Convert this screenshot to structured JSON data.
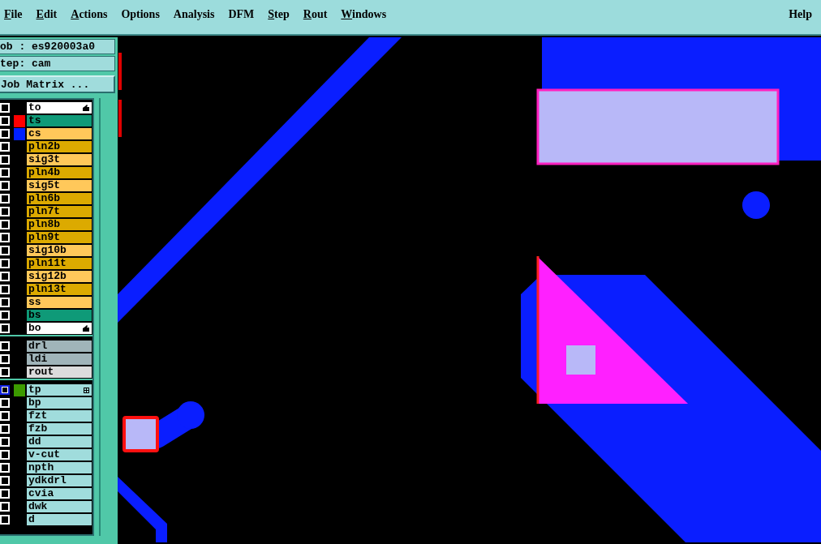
{
  "menu_bar": {
    "items": [
      {
        "label": "File",
        "underline_first": true
      },
      {
        "label": "Edit",
        "underline_first": true
      },
      {
        "label": "Actions",
        "underline_first": true
      },
      {
        "label": "Options",
        "underline_first": false
      },
      {
        "label": "Analysis",
        "underline_first": false
      },
      {
        "label": "DFM",
        "underline_first": false
      },
      {
        "label": "Step",
        "underline_first": true
      },
      {
        "label": "Rout",
        "underline_first": true
      },
      {
        "label": "Windows",
        "underline_first": true
      }
    ],
    "help": "Help"
  },
  "job_label": "ob : es920003a0",
  "step_label": "tep: cam",
  "job_matrix_button": "Job Matrix ...",
  "layer_groups": [
    {
      "layers": [
        {
          "name": "to",
          "color": "#ffffff",
          "kind": "hand",
          "selected": false
        },
        {
          "name": "ts",
          "color": "#0f9a78",
          "swatch": {
            "color": "#ff0000"
          },
          "kind": "plain",
          "selected": false
        },
        {
          "name": "cs",
          "color": "#ffc85a",
          "swatch": {
            "color": "#0020ff"
          },
          "kind": "plain",
          "selected": false
        },
        {
          "name": "pln2b",
          "color": "#dcaa00",
          "kind": "plain",
          "selected": false
        },
        {
          "name": "sig3t",
          "color": "#ffc85a",
          "kind": "plain",
          "selected": false
        },
        {
          "name": "pln4b",
          "color": "#dcaa00",
          "kind": "plain",
          "selected": false
        },
        {
          "name": "sig5t",
          "color": "#ffc85a",
          "kind": "plain",
          "selected": false
        },
        {
          "name": "pln6b",
          "color": "#dcaa00",
          "kind": "plain",
          "selected": false
        },
        {
          "name": "pln7t",
          "color": "#dcaa00",
          "kind": "plain",
          "selected": false
        },
        {
          "name": "pln8b",
          "color": "#dcaa00",
          "kind": "plain",
          "selected": false
        },
        {
          "name": "pln9t",
          "color": "#dcaa00",
          "kind": "plain",
          "selected": false
        },
        {
          "name": "sig10b",
          "color": "#ffc85a",
          "kind": "plain",
          "selected": false
        },
        {
          "name": "pln11t",
          "color": "#dcaa00",
          "kind": "plain",
          "selected": false
        },
        {
          "name": "sig12b",
          "color": "#ffc85a",
          "kind": "plain",
          "selected": false
        },
        {
          "name": "pln13t",
          "color": "#dcaa00",
          "kind": "plain",
          "selected": false
        },
        {
          "name": "ss",
          "color": "#ffc85a",
          "kind": "plain",
          "selected": false
        },
        {
          "name": "bs",
          "color": "#0f9a78",
          "kind": "plain",
          "selected": false
        },
        {
          "name": "bo",
          "color": "#ffffff",
          "kind": "hand",
          "selected": false
        }
      ]
    },
    {
      "layers": [
        {
          "name": "drl",
          "color": "#a0b4b9",
          "kind": "plain",
          "selected": false
        },
        {
          "name": "ldi",
          "color": "#a0b4b9",
          "kind": "plain",
          "selected": false
        },
        {
          "name": "rout",
          "color": "#dcdcdc",
          "kind": "plain",
          "selected": false
        }
      ]
    },
    {
      "layers": [
        {
          "name": "tp",
          "color": "#a0dcdc",
          "swatch": {
            "color": "#3c9a00"
          },
          "kind": "grid",
          "selected": true
        },
        {
          "name": "bp",
          "color": "#a0dcdc",
          "kind": "plain",
          "selected": false
        },
        {
          "name": "fzt",
          "color": "#a0dcdc",
          "kind": "plain",
          "selected": false
        },
        {
          "name": "fzb",
          "color": "#a0dcdc",
          "kind": "plain",
          "selected": false
        },
        {
          "name": "dd",
          "color": "#a0dcdc",
          "kind": "plain",
          "selected": false
        },
        {
          "name": "v-cut",
          "color": "#a0dcdc",
          "kind": "plain",
          "selected": false
        },
        {
          "name": "npth",
          "color": "#a0dcdc",
          "kind": "plain",
          "selected": false
        },
        {
          "name": "ydkdrl",
          "color": "#a0dcdc",
          "kind": "plain",
          "selected": false
        },
        {
          "name": "cvia",
          "color": "#a0dcdc",
          "kind": "plain",
          "selected": false
        },
        {
          "name": "dwk",
          "color": "#a0dcdc",
          "kind": "plain",
          "selected": false
        },
        {
          "name": "d",
          "color": "#a0dcdc",
          "kind": "plain",
          "selected": false
        }
      ]
    }
  ]
}
